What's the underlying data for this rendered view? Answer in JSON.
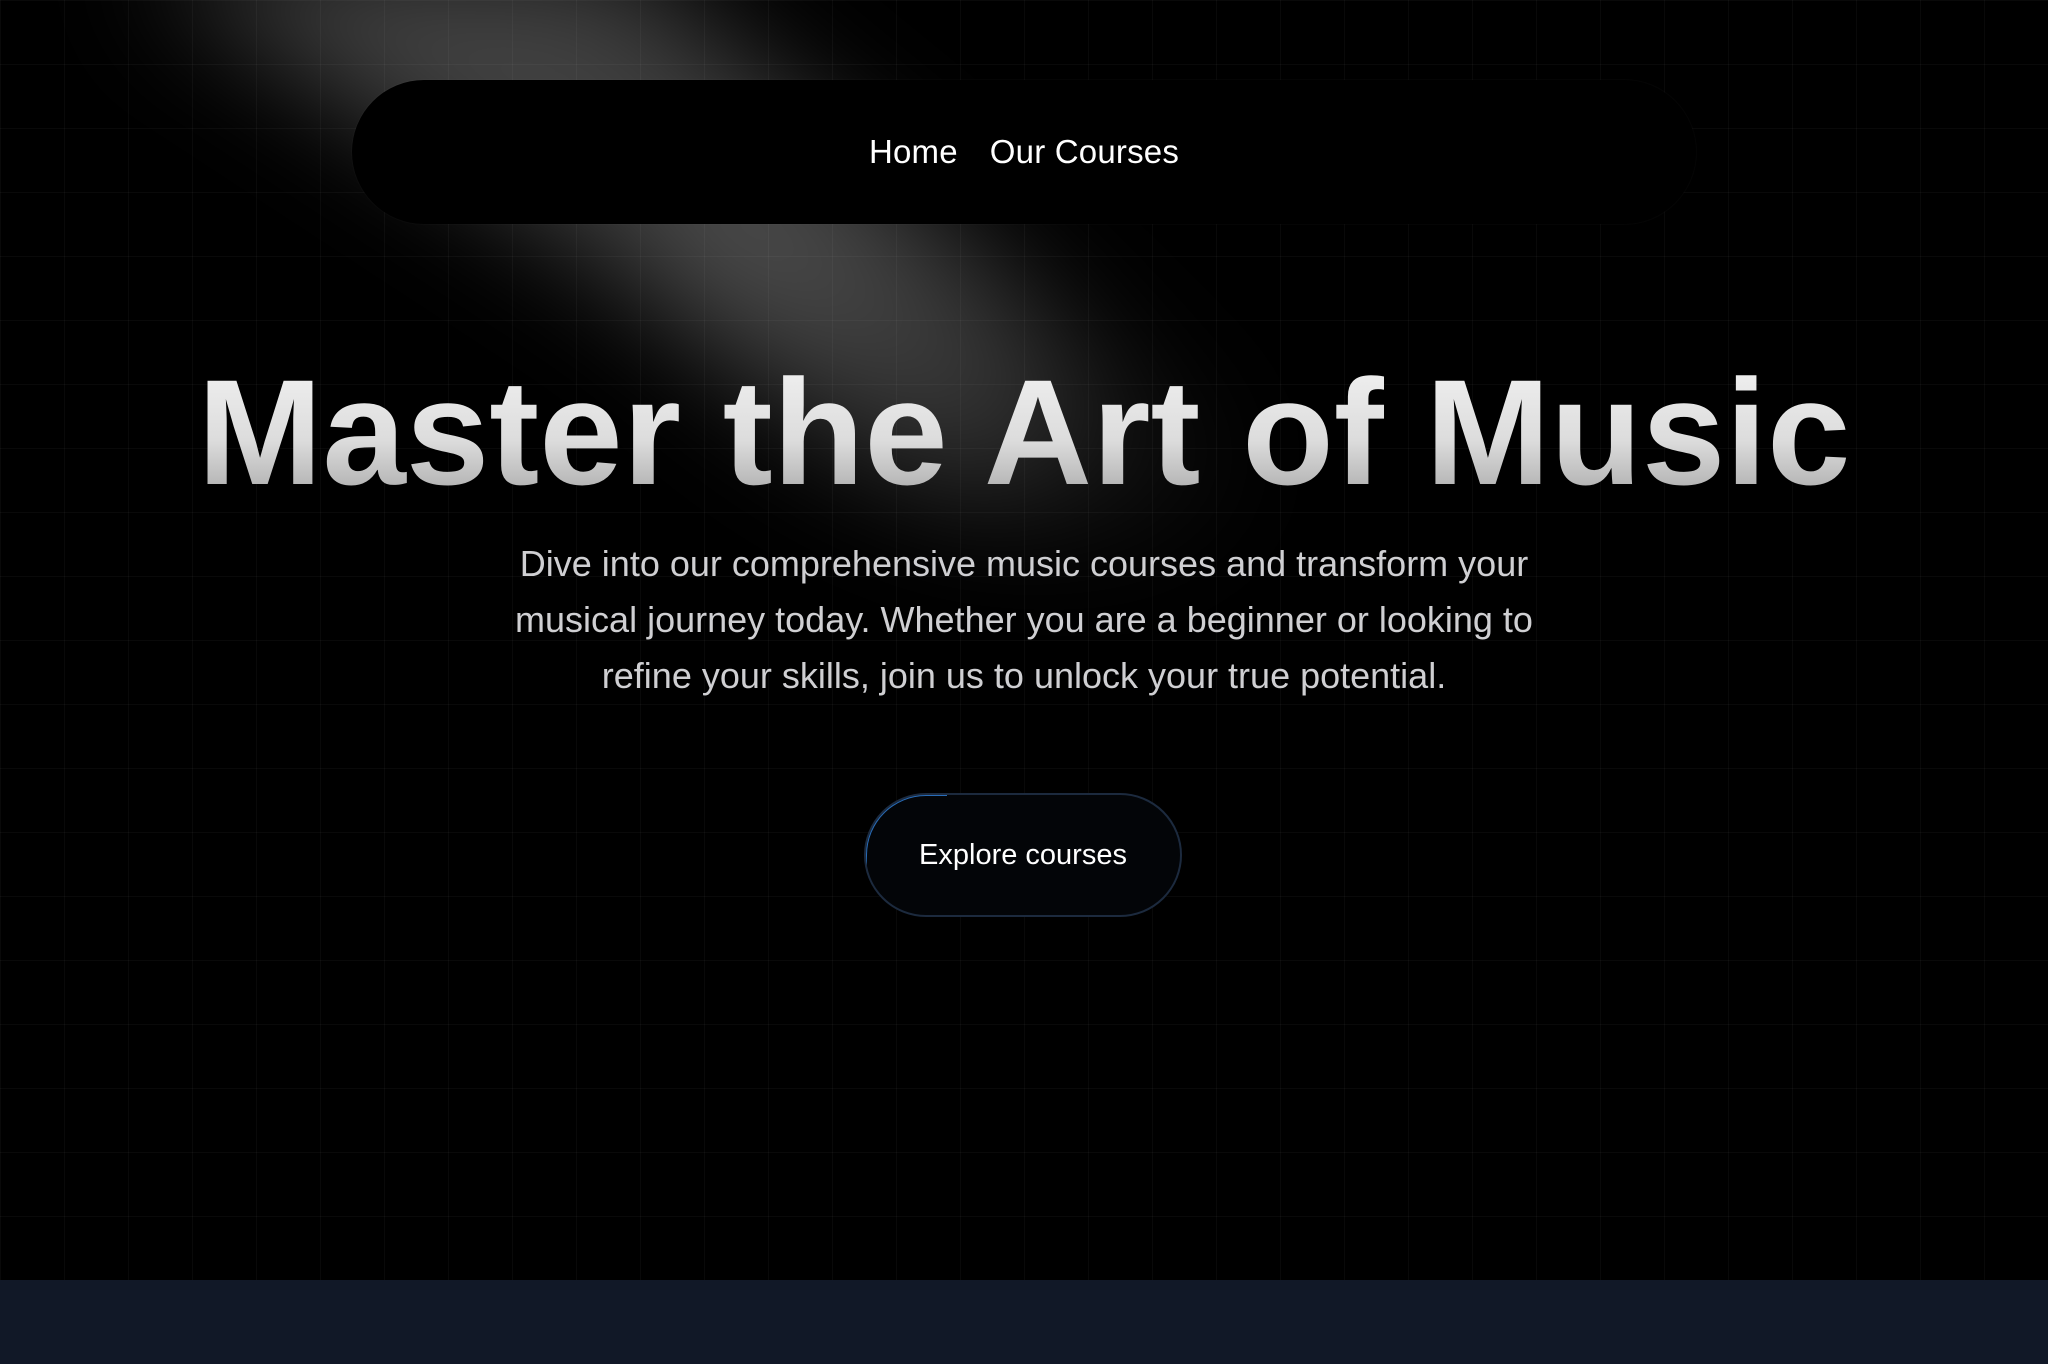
{
  "nav": {
    "links": [
      {
        "label": "Home"
      },
      {
        "label": "Our Courses"
      }
    ]
  },
  "hero": {
    "headline": "Master the Art of Music",
    "subtitle": "Dive into our comprehensive music courses and transform your musical journey today. Whether you are a beginner or looking to refine your skills, join us to unlock your true potential.",
    "cta_label": "Explore courses"
  },
  "colors": {
    "page_background": "#000000",
    "footer_band": "#111827",
    "cta_accent": "#2f7fd8",
    "text_primary": "#ffffff",
    "text_secondary": "#cfcfd2"
  }
}
